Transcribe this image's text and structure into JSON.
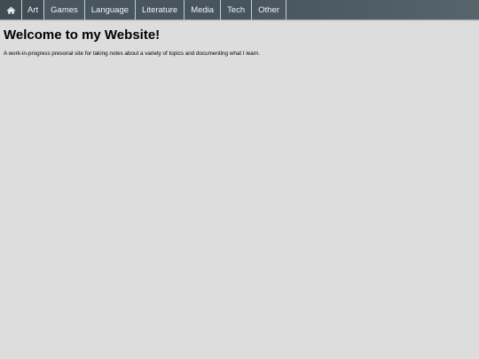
{
  "nav": {
    "home_icon": "home-icon",
    "items": [
      {
        "label": "Art"
      },
      {
        "label": "Games"
      },
      {
        "label": "Language"
      },
      {
        "label": "Literature"
      },
      {
        "label": "Media"
      },
      {
        "label": "Tech"
      },
      {
        "label": "Other"
      }
    ]
  },
  "main": {
    "title": "Welcome to my Website!",
    "intro": "A work-in-progress presonal site for taking notes about a variety of topics and documenting what I learn."
  },
  "colors": {
    "background": "#dddddd",
    "navbar": "#4a5860",
    "nav_text": "#f2f2f2"
  }
}
